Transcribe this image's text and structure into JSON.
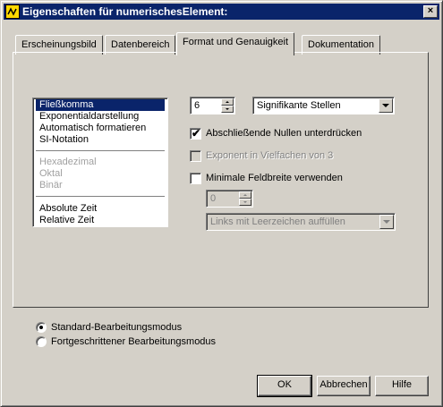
{
  "window": {
    "title": "Eigenschaften für numerischesElement:",
    "close_glyph": "×"
  },
  "tabs": [
    {
      "label": "Erscheinungsbild",
      "active": false
    },
    {
      "label": "Datenbereich",
      "active": false
    },
    {
      "label": "Format und Genauigkeit",
      "active": true
    },
    {
      "label": "Dokumentation",
      "active": false
    }
  ],
  "format_list": {
    "items": [
      {
        "label": "Fließkomma",
        "selected": true,
        "enabled": true
      },
      {
        "label": "Exponentialdarstellung",
        "selected": false,
        "enabled": true
      },
      {
        "label": "Automatisch formatieren",
        "selected": false,
        "enabled": true
      },
      {
        "label": "SI-Notation",
        "selected": false,
        "enabled": true
      },
      {
        "label": "Hexadezimal",
        "selected": false,
        "enabled": false
      },
      {
        "label": "Oktal",
        "selected": false,
        "enabled": false
      },
      {
        "label": "Binär",
        "selected": false,
        "enabled": false
      },
      {
        "label": "Absolute Zeit",
        "selected": false,
        "enabled": true
      },
      {
        "label": "Relative Zeit",
        "selected": false,
        "enabled": true
      }
    ]
  },
  "precision": {
    "digits": "6",
    "type": "Signifikante Stellen"
  },
  "options": {
    "suppress_zeros": {
      "label": "Abschließende Nullen unterdrücken",
      "checked": true,
      "enabled": true
    },
    "exponent_multiple": {
      "label": "Exponent in Vielfachen von 3",
      "checked": false,
      "enabled": false
    },
    "min_width": {
      "label": "Minimale Feldbreite verwenden",
      "checked": false,
      "enabled": true
    },
    "min_width_value": "0",
    "padding_mode": "Links mit Leerzeichen auffüllen"
  },
  "edit_mode": {
    "standard": {
      "label": "Standard-Bearbeitungsmodus",
      "selected": true
    },
    "advanced": {
      "label": "Fortgeschrittener Bearbeitungsmodus",
      "selected": false
    }
  },
  "buttons": {
    "ok": "OK",
    "cancel": "Abbrechen",
    "help": "Hilfe"
  },
  "colors": {
    "titlebar": "#0a246a",
    "dialog_bg": "#d4d0c8",
    "selection": "#0a246a"
  }
}
